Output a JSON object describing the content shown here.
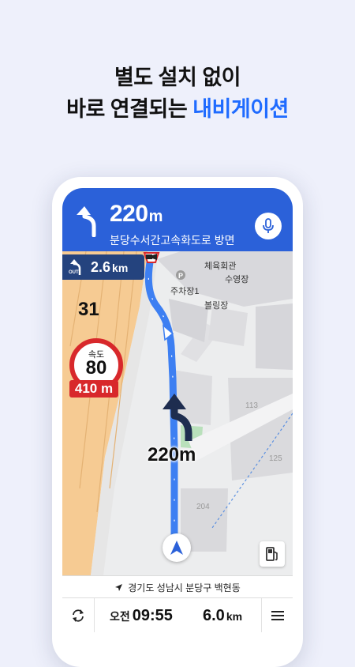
{
  "headline": {
    "line1": "별도 설치 없이",
    "line2_prefix": "바로 연결되는 ",
    "line2_accent": "내비게이션"
  },
  "nav": {
    "distance_value": "220",
    "distance_unit": "m",
    "road_name": "분당수서간고속화도로 방면",
    "next_turn_badge": "OUT",
    "next_turn_value": "2.6",
    "next_turn_unit": "km",
    "road_number": "31",
    "speed_label": "속도",
    "speed_limit": "80",
    "camera_distance": "410 m",
    "route_distance_label": "220m"
  },
  "map_labels": {
    "gym": "체육회관",
    "pool": "수영장",
    "parking": "주차장1",
    "parking_symbol": "P",
    "bowling": "볼링장",
    "n113": "113",
    "n125": "125",
    "n204": "204"
  },
  "location": {
    "text": "경기도 성남시 분당구 백현동"
  },
  "status": {
    "ampm": "오전",
    "time": "09:55",
    "remaining_value": "6.0",
    "remaining_unit": "km"
  },
  "colors": {
    "accent": "#1f6bff",
    "top_bar": "#2b61d9",
    "route": "#3d7ff2",
    "speed_red": "#d8282b",
    "highway": "#f5c990"
  },
  "icons": {
    "turn": "turn-left-arrow-icon",
    "mic": "microphone-icon",
    "gps": "navigation-arrow-icon",
    "fuel": "gas-station-icon",
    "refresh": "reroute-icon",
    "menu": "hamburger-menu-icon",
    "location": "location-arrow-icon"
  }
}
